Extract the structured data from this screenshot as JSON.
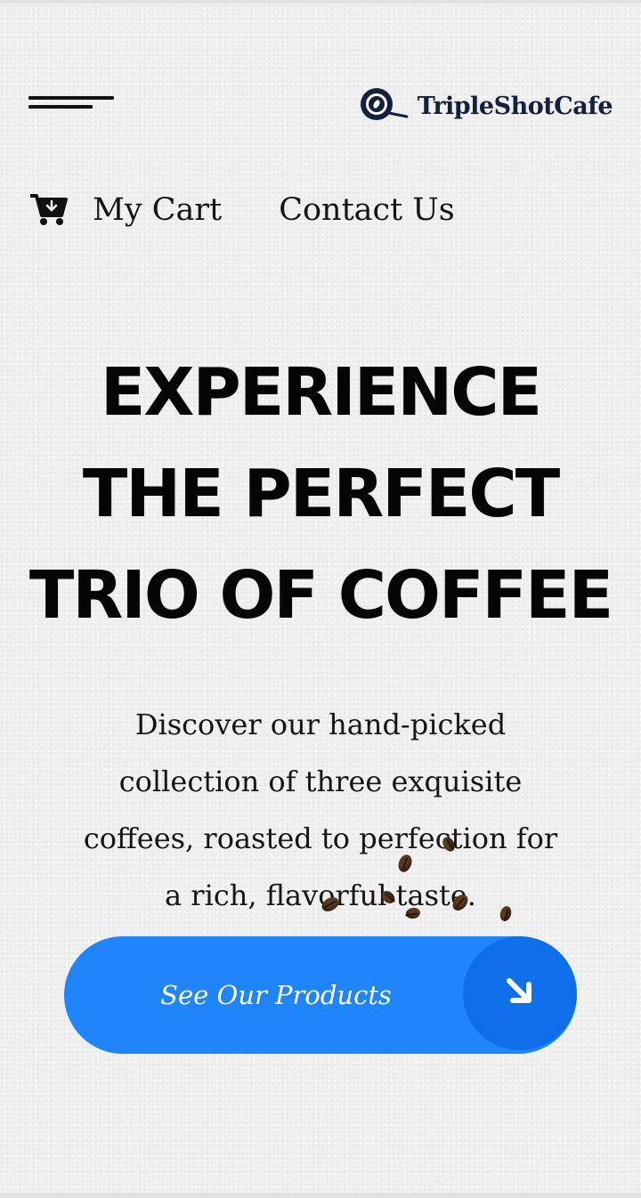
{
  "header": {
    "menu_icon": "hamburger-menu-icon",
    "logo_icon": "coffee-cup-icon",
    "logo_text": "TripleShotCafe"
  },
  "nav": {
    "cart_icon": "shopping-cart-icon",
    "cart_label": "My Cart",
    "contact_label": "Contact Us"
  },
  "hero": {
    "title_line1": "Experience",
    "title_line2": "The Perfect",
    "title_line3": "Trio of Coffee",
    "desc_line1": "Discover our hand-picked",
    "desc_line2": "collection of three exquisite",
    "desc_line3": "coffees, roasted to perfection for",
    "desc_line4": "a rich, flavorful taste."
  },
  "cta": {
    "label": "See Our Products",
    "icon": "arrow-down-right-icon"
  },
  "colors": {
    "background": "#f0f0f0",
    "logo": "#14213d",
    "cta": "#2085fb",
    "cta_circle": "#0f6fe9",
    "bean": "#5b3a20"
  }
}
